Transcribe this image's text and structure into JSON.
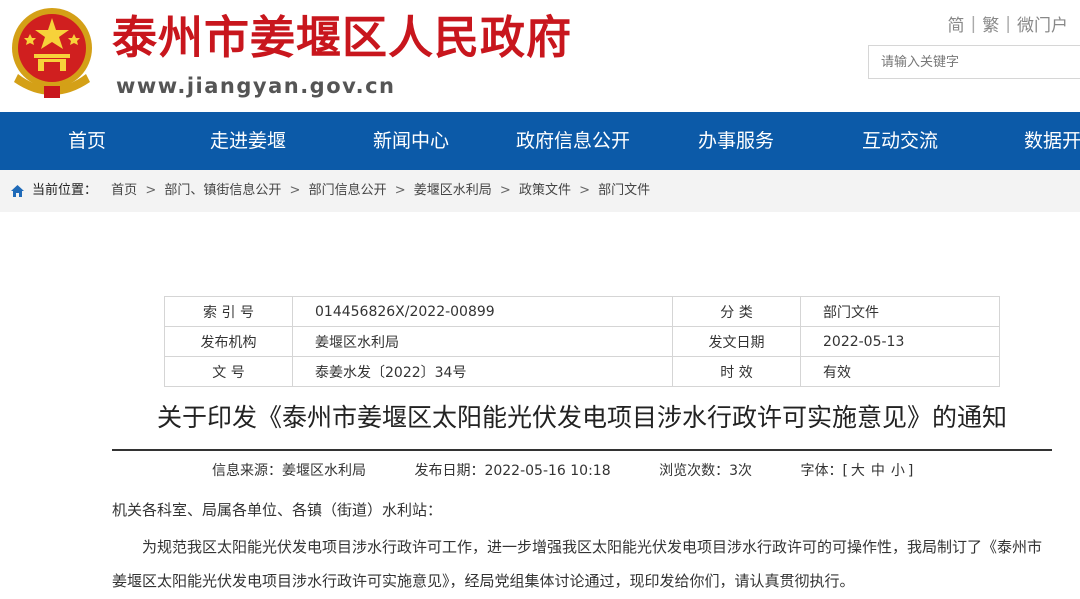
{
  "header": {
    "site_title": "泰州市姜堰区人民政府",
    "site_url": "www.jiangyan.gov.cn",
    "lang_links": [
      "简",
      "繁",
      "微门户"
    ],
    "search_placeholder": "请输入关键字",
    "title_color": "#c8161d",
    "emblem_icon": "national-emblem-icon"
  },
  "nav": {
    "background": "#0c5aa8",
    "items": [
      "首页",
      "走进姜堰",
      "新闻中心",
      "政府信息公开",
      "办事服务",
      "互动交流",
      "数据开放"
    ]
  },
  "breadcrumb": {
    "label": "当前位置：",
    "items": [
      "首页",
      "部门、镇街信息公开",
      "部门信息公开",
      "姜堰区水利局",
      "政策文件",
      "部门文件"
    ]
  },
  "info": {
    "index_label": "索 引 号",
    "index_value": "014456826X/2022-00899",
    "category_label": "分 类",
    "category_value": "部门文件",
    "publisher_label": "发布机构",
    "publisher_value": "姜堰区水利局",
    "date_label": "发文日期",
    "date_value": "2022-05-13",
    "docno_label": "文 号",
    "docno_value": "泰姜水发〔2022〕34号",
    "validity_label": "时 效",
    "validity_value": "有效"
  },
  "article": {
    "title": "关于印发《泰州市姜堰区太阳能光伏发电项目涉水行政许可实施意见》的通知",
    "source": "信息来源：姜堰区水利局",
    "publish_time": "发布日期：2022-05-16 10:18",
    "views": "浏览次数：3次",
    "font_label": "字体：[",
    "font_sizes": [
      "大",
      "中",
      "小"
    ],
    "font_close": "]",
    "salutation": "机关各科室、局属各单位、各镇（街道）水利站：",
    "paragraph": "为规范我区太阳能光伏发电项目涉水行政许可工作，进一步增强我区太阳能光伏发电项目涉水行政许可的可操作性，我局制订了《泰州市姜堰区太阳能光伏发电项目涉水行政许可实施意见》，经局党组集体讨论通过，现印发给你们，请认真贯彻执行。"
  }
}
